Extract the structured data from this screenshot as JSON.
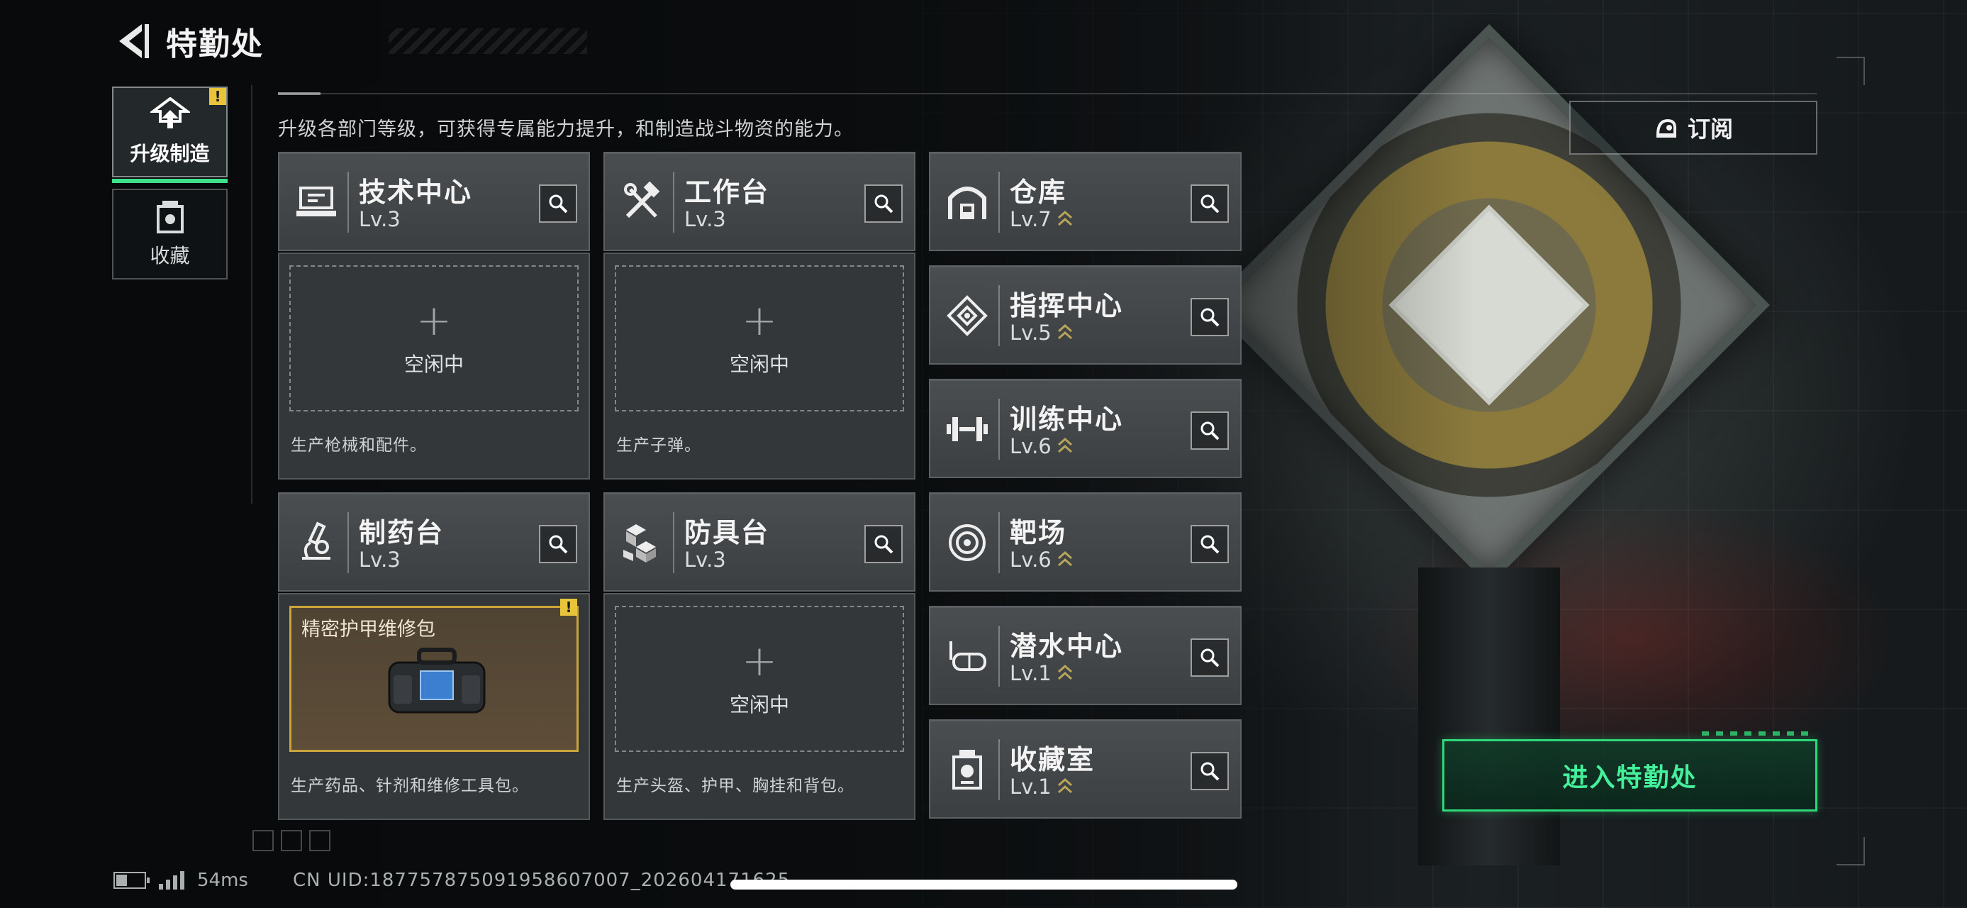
{
  "header": {
    "title": "特勤处",
    "back_icon": "back-arrow-icon"
  },
  "description": "升级各部门等级，可获得专属能力提升，和制造战斗物资的能力。",
  "side_tabs": [
    {
      "label": "升级制造",
      "icon": "upgrade-icon",
      "active": true,
      "badge": "!"
    },
    {
      "label": "收藏",
      "icon": "collection-icon",
      "active": false
    }
  ],
  "subscribe": {
    "label": "订阅",
    "icon": "subscribe-icon"
  },
  "workstations": [
    {
      "name": "技术中心",
      "level": "Lv.3",
      "icon": "tech-center-icon",
      "slot_status": "空闲中",
      "caption": "生产枪械和配件。"
    },
    {
      "name": "工作台",
      "level": "Lv.3",
      "icon": "workbench-icon",
      "slot_status": "空闲中",
      "caption": "生产子弹。"
    },
    {
      "name": "制药台",
      "level": "Lv.3",
      "icon": "pharmacy-icon",
      "crafting_item": "精密护甲维修包",
      "badge": "!",
      "caption": "生产药品、针剂和维修工具包。"
    },
    {
      "name": "防具台",
      "level": "Lv.3",
      "icon": "armor-bench-icon",
      "slot_status": "空闲中",
      "caption": "生产头盔、护甲、胸挂和背包。"
    }
  ],
  "facilities": [
    {
      "name": "仓库",
      "level": "Lv.7",
      "icon": "warehouse-icon",
      "upgradable": true
    },
    {
      "name": "指挥中心",
      "level": "Lv.5",
      "icon": "command-center-icon",
      "upgradable": true
    },
    {
      "name": "训练中心",
      "level": "Lv.6",
      "icon": "training-center-icon",
      "upgradable": true
    },
    {
      "name": "靶场",
      "level": "Lv.6",
      "icon": "shooting-range-icon",
      "upgradable": true
    },
    {
      "name": "潜水中心",
      "level": "Lv.1",
      "icon": "diving-center-icon",
      "upgradable": true
    },
    {
      "name": "收藏室",
      "level": "Lv.1",
      "icon": "collection-room-icon",
      "upgradable": true
    }
  ],
  "enter_button": {
    "label": "进入特勤处"
  },
  "status_bar": {
    "ping": "54ms",
    "uid": "CN UID:18775787509195860​7007_202604171625",
    "battery_level": 0.4
  },
  "colors": {
    "accent_green": "#2fd878",
    "warning_yellow": "#e7c43a",
    "upgrade_chevron": "#b7a55a"
  }
}
